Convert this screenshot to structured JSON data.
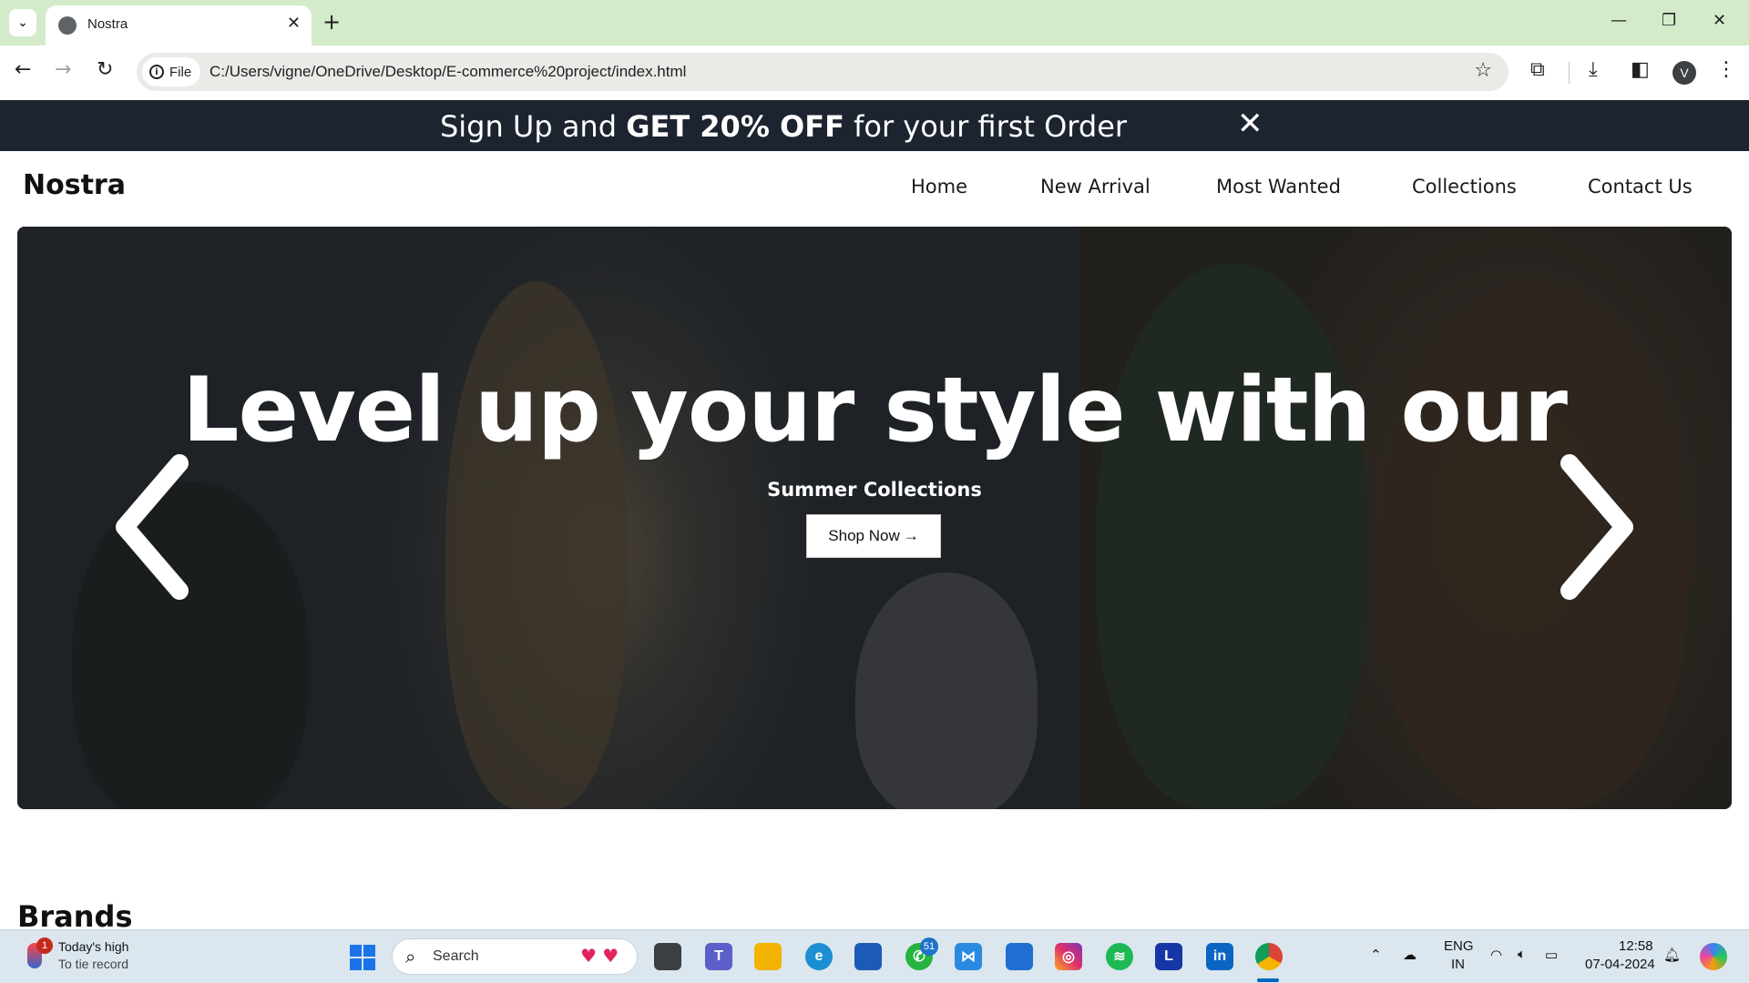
{
  "browser": {
    "tab_title": "Nostra",
    "tab_close": "✕",
    "new_tab": "+",
    "window_controls": [
      "—",
      "❐",
      "✕"
    ],
    "nav": {
      "back": "←",
      "forward": "→",
      "reload": "↻"
    },
    "file_chip": "File",
    "url": "C:/Users/vigne/OneDrive/Desktop/E-commerce%20project/index.html",
    "profile_initial": "V",
    "icons": [
      "extensions-icon",
      "download-icon",
      "sidepanel-icon",
      "menu-icon"
    ]
  },
  "promo": {
    "prefix": "Sign Up and ",
    "highlight": "GET 20% OFF",
    "suffix": " for your first Order",
    "close": "✕"
  },
  "site": {
    "logo": "Nostra",
    "nav": [
      "Home",
      "New Arrival",
      "Most Wanted",
      "Collections",
      "Contact Us"
    ]
  },
  "hero": {
    "title": "Level up your style with our",
    "subtitle": "Summer Collections",
    "cta": "Shop Now",
    "cta_arrow": "→"
  },
  "brands_heading": "Brands",
  "taskbar": {
    "weather_badge": "1",
    "weather_line1": "Today's high",
    "weather_line2": "To tie record",
    "search_label": "Search",
    "whatsapp_badge": "51",
    "lang_line1": "ENG",
    "lang_line2": "IN",
    "time": "12:58",
    "date": "07-04-2024",
    "apps": [
      "task-view",
      "teams",
      "file-explorer",
      "edge",
      "store",
      "whatsapp",
      "vscode",
      "app",
      "instagram",
      "spotify",
      "l-app",
      "linkedin",
      "chrome"
    ]
  }
}
